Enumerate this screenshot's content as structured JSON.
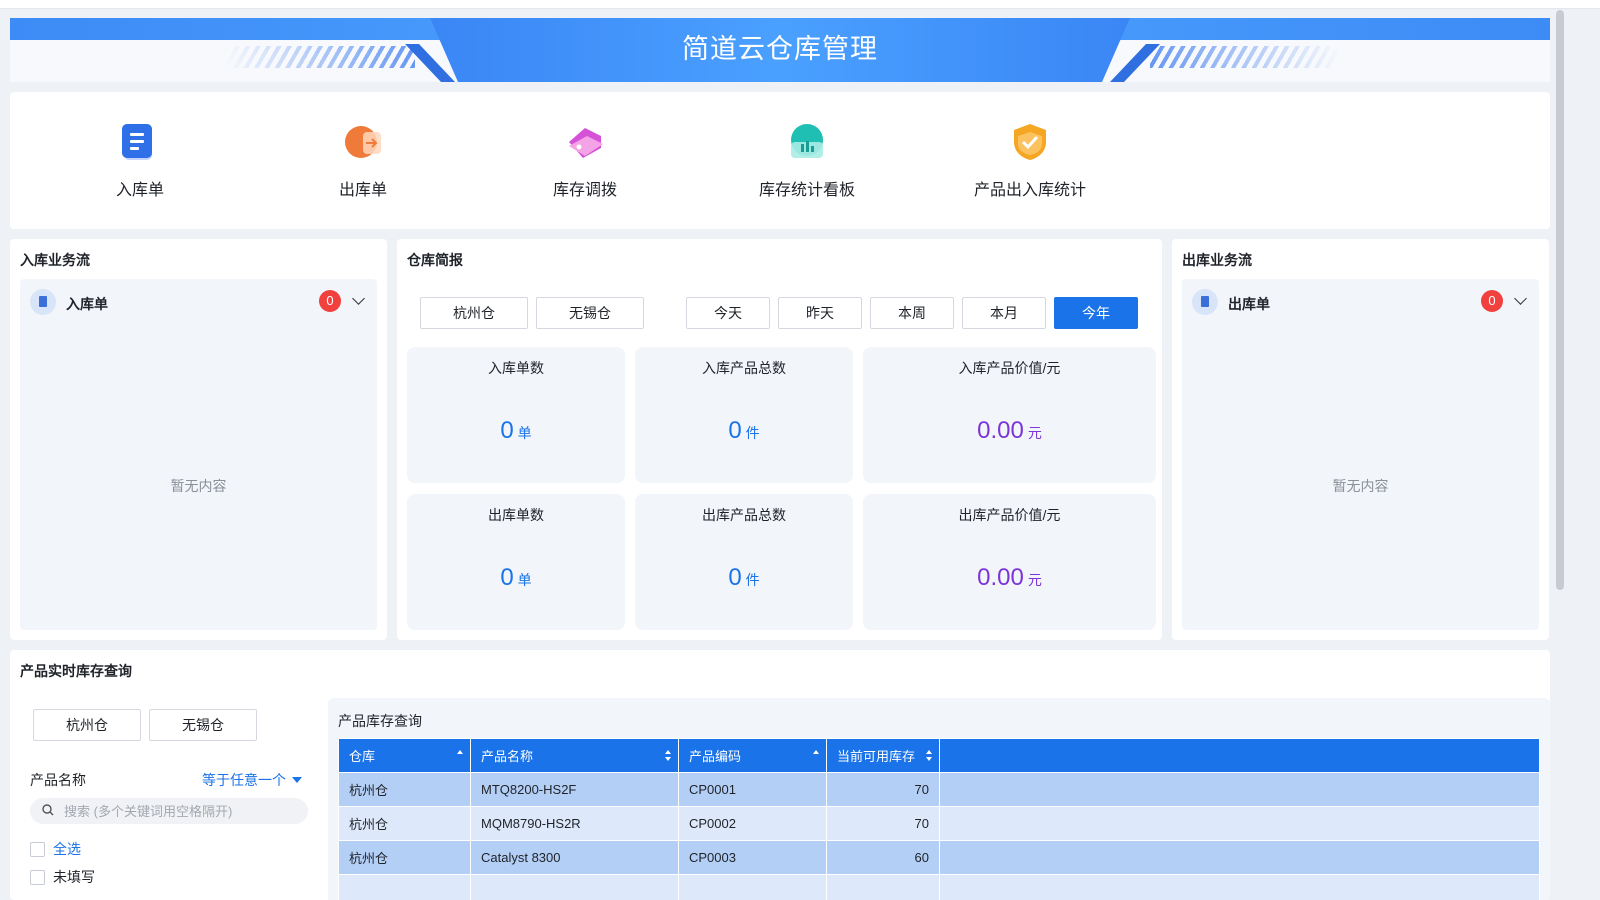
{
  "app": {
    "title": "简道云仓库管理"
  },
  "nav": {
    "items": [
      {
        "label": "入库单",
        "icon": "inbound-doc-icon"
      },
      {
        "label": "出库单",
        "icon": "outbound-doc-icon"
      },
      {
        "label": "库存调拨",
        "icon": "transfer-tag-icon"
      },
      {
        "label": "库存统计看板",
        "icon": "chart-dashboard-icon"
      },
      {
        "label": "产品出入库统计",
        "icon": "shield-check-icon"
      }
    ]
  },
  "inbound_flow": {
    "title": "入库业务流",
    "item_label": "入库单",
    "count": "0",
    "empty": "暂无内容"
  },
  "outbound_flow": {
    "title": "出库业务流",
    "item_label": "出库单",
    "count": "0",
    "empty": "暂无内容"
  },
  "briefing": {
    "title": "仓库简报",
    "warehouses": [
      "杭州仓",
      "无锡仓"
    ],
    "periods": [
      "今天",
      "昨天",
      "本周",
      "本月",
      "今年"
    ],
    "active_period": "今年",
    "stats": [
      {
        "label": "入库单数",
        "value": "0",
        "unit": "单"
      },
      {
        "label": "入库产品总数",
        "value": "0",
        "unit": "件"
      },
      {
        "label": "入库产品价值/元",
        "value": "0.00",
        "unit": "元"
      },
      {
        "label": "出库单数",
        "value": "0",
        "unit": "单"
      },
      {
        "label": "出库产品总数",
        "value": "0",
        "unit": "件"
      },
      {
        "label": "出库产品价值/元",
        "value": "0.00",
        "unit": "元"
      }
    ]
  },
  "stock_query": {
    "title": "产品实时库存查询",
    "warehouses": [
      "杭州仓",
      "无锡仓"
    ],
    "filter": {
      "field_label": "产品名称",
      "operator": "等于任意一个",
      "search_placeholder": "搜索 (多个关键词用空格隔开)",
      "options": [
        "全选",
        "未填写"
      ]
    },
    "table": {
      "title": "产品库存查询",
      "columns": [
        "仓库",
        "产品名称",
        "产品编码",
        "当前可用库存"
      ],
      "rows": [
        [
          "杭州仓",
          "MTQ8200-HS2F",
          "CP0001",
          "70"
        ],
        [
          "杭州仓",
          "MQM8790-HS2R",
          "CP0002",
          "70"
        ],
        [
          "杭州仓",
          "Catalyst 8300",
          "CP0003",
          "60"
        ]
      ]
    }
  },
  "colors": {
    "accent": "#1a73e8",
    "purple": "#7b35d8",
    "badge": "#f0413e"
  }
}
